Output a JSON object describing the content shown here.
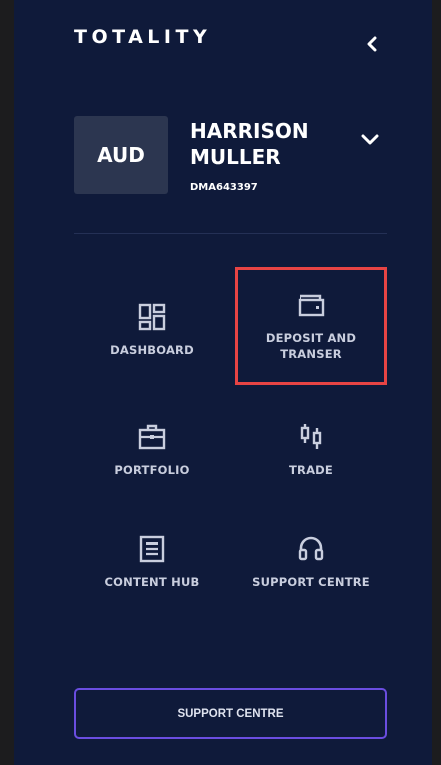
{
  "brand": {
    "name": "TOTALITY"
  },
  "account": {
    "currency": "AUD",
    "name": "HARRISON MULLER",
    "id": "DMA643397"
  },
  "nav": {
    "items": [
      {
        "key": "dashboard",
        "label": "DASHBOARD",
        "icon": "dashboard-icon"
      },
      {
        "key": "deposit",
        "label": "DEPOSIT AND TRANSER",
        "icon": "wallet-icon"
      },
      {
        "key": "portfolio",
        "label": "PORTFOLIO",
        "icon": "briefcase-icon"
      },
      {
        "key": "trade",
        "label": "TRADE",
        "icon": "candlestick-icon"
      },
      {
        "key": "content-hub",
        "label": "CONTENT HUB",
        "icon": "article-icon"
      },
      {
        "key": "support",
        "label": "SUPPORT CENTRE",
        "icon": "headset-icon"
      }
    ]
  },
  "footer": {
    "button_label": "SUPPORT CENTRE"
  },
  "colors": {
    "panel_bg": "#0f1a3a",
    "page_bg": "#1c1c1e",
    "highlight": "#e74444",
    "button_border": "#6a4de0"
  }
}
